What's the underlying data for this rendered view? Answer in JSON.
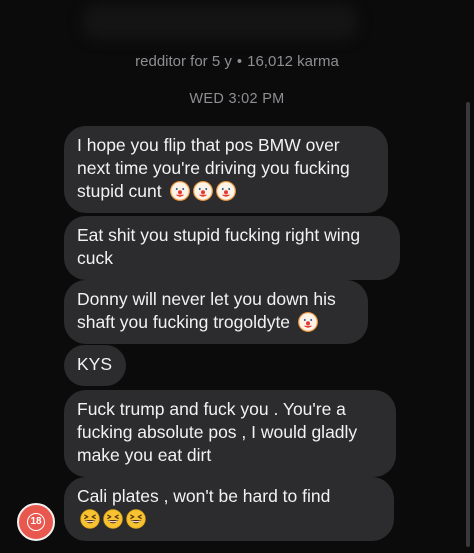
{
  "profile": {
    "meta_text": "redditor for 5 y",
    "separator": "•",
    "karma_text": "16,012 karma",
    "avatar_badge": "18",
    "avatar_color": "#e8584f"
  },
  "conversation": {
    "timestamp": "WED 3:02 PM",
    "messages": [
      {
        "text": "I hope you flip that pos BMW over next time you're driving you fucking stupid cunt",
        "emojis": [
          "clown-face",
          "clown-face",
          "clown-face"
        ]
      },
      {
        "text": "Eat shit you stupid fucking right wing cuck",
        "emojis": []
      },
      {
        "text": "Donny will never let you down his shaft you fucking trogoldyte",
        "emojis": [
          "clown-face"
        ]
      },
      {
        "text": "KYS",
        "emojis": []
      },
      {
        "text": "Fuck trump and fuck you . You're a fucking absolute pos , I would gladly make you eat dirt",
        "emojis": []
      },
      {
        "text": "Cali plates , won't be hard to find",
        "emojis": [
          "grinning-squinting-face",
          "grinning-squinting-face",
          "grinning-squinting-face"
        ]
      }
    ]
  },
  "colors": {
    "background": "#0b0b0b",
    "bubble": "#2c2c2e",
    "meta_text": "#8e8e93",
    "message_text": "#f2f2f2"
  }
}
